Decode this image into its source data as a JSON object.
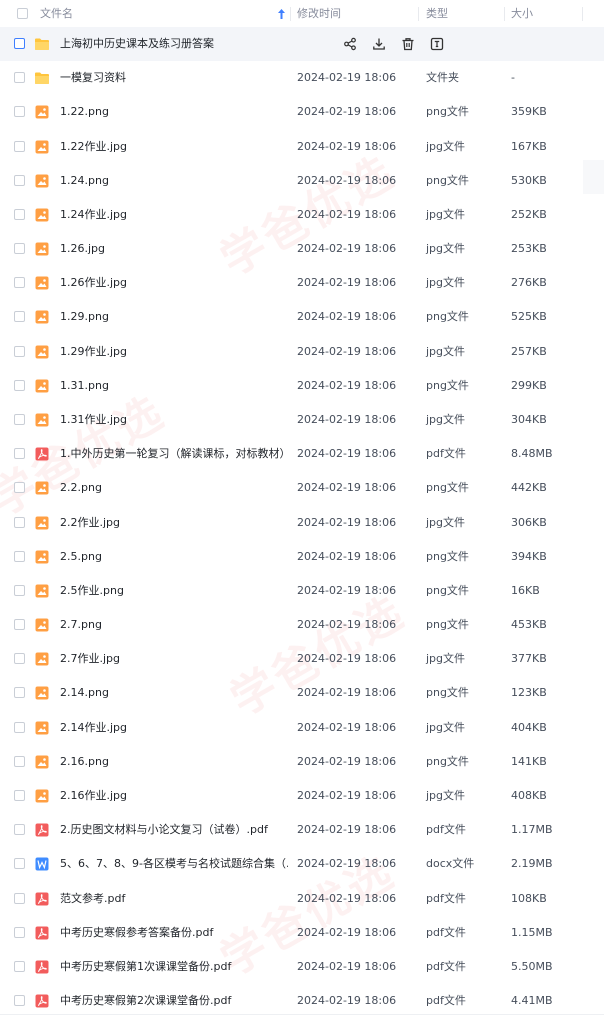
{
  "header": {
    "col_name": "文件名",
    "col_date": "修改时间",
    "col_type": "类型",
    "col_size": "大小"
  },
  "colors": {
    "accent": "#3f7fff",
    "folder": "#ffc53d",
    "image": "#ff9f43",
    "pdf": "#f25c5c",
    "word": "#3f8cff"
  },
  "selected_row_actions": [
    "share-icon",
    "download-icon",
    "delete-icon",
    "rename-icon"
  ],
  "rows": [
    {
      "name": "上海初中历史课本及练习册答案",
      "date": "",
      "type": "",
      "size": "",
      "icon": "folder"
    },
    {
      "name": "一模复习资料",
      "date": "2024-02-19 18:06",
      "type": "文件夹",
      "size": "-",
      "icon": "folder"
    },
    {
      "name": "1.22.png",
      "date": "2024-02-19 18:06",
      "type": "png文件",
      "size": "359KB",
      "icon": "image"
    },
    {
      "name": "1.22作业.jpg",
      "date": "2024-02-19 18:06",
      "type": "jpg文件",
      "size": "167KB",
      "icon": "image"
    },
    {
      "name": "1.24.png",
      "date": "2024-02-19 18:06",
      "type": "png文件",
      "size": "530KB",
      "icon": "image"
    },
    {
      "name": "1.24作业.jpg",
      "date": "2024-02-19 18:06",
      "type": "jpg文件",
      "size": "252KB",
      "icon": "image"
    },
    {
      "name": "1.26.jpg",
      "date": "2024-02-19 18:06",
      "type": "jpg文件",
      "size": "253KB",
      "icon": "image"
    },
    {
      "name": "1.26作业.jpg",
      "date": "2024-02-19 18:06",
      "type": "jpg文件",
      "size": "276KB",
      "icon": "image"
    },
    {
      "name": "1.29.png",
      "date": "2024-02-19 18:06",
      "type": "png文件",
      "size": "525KB",
      "icon": "image"
    },
    {
      "name": "1.29作业.jpg",
      "date": "2024-02-19 18:06",
      "type": "jpg文件",
      "size": "257KB",
      "icon": "image"
    },
    {
      "name": "1.31.png",
      "date": "2024-02-19 18:06",
      "type": "png文件",
      "size": "299KB",
      "icon": "image"
    },
    {
      "name": "1.31作业.jpg",
      "date": "2024-02-19 18:06",
      "type": "jpg文件",
      "size": "304KB",
      "icon": "image"
    },
    {
      "name": "1.中外历史第一轮复习（解读课标，对标教材）....",
      "date": "2024-02-19 18:06",
      "type": "pdf文件",
      "size": "8.48MB",
      "icon": "pdf"
    },
    {
      "name": "2.2.png",
      "date": "2024-02-19 18:06",
      "type": "png文件",
      "size": "442KB",
      "icon": "image"
    },
    {
      "name": "2.2作业.jpg",
      "date": "2024-02-19 18:06",
      "type": "jpg文件",
      "size": "306KB",
      "icon": "image"
    },
    {
      "name": "2.5.png",
      "date": "2024-02-19 18:06",
      "type": "png文件",
      "size": "394KB",
      "icon": "image"
    },
    {
      "name": "2.5作业.png",
      "date": "2024-02-19 18:06",
      "type": "png文件",
      "size": "16KB",
      "icon": "image"
    },
    {
      "name": "2.7.png",
      "date": "2024-02-19 18:06",
      "type": "png文件",
      "size": "453KB",
      "icon": "image"
    },
    {
      "name": "2.7作业.jpg",
      "date": "2024-02-19 18:06",
      "type": "jpg文件",
      "size": "377KB",
      "icon": "image"
    },
    {
      "name": "2.14.png",
      "date": "2024-02-19 18:06",
      "type": "png文件",
      "size": "123KB",
      "icon": "image"
    },
    {
      "name": "2.14作业.jpg",
      "date": "2024-02-19 18:06",
      "type": "jpg文件",
      "size": "404KB",
      "icon": "image"
    },
    {
      "name": "2.16.png",
      "date": "2024-02-19 18:06",
      "type": "png文件",
      "size": "141KB",
      "icon": "image"
    },
    {
      "name": "2.16作业.jpg",
      "date": "2024-02-19 18:06",
      "type": "jpg文件",
      "size": "408KB",
      "icon": "image"
    },
    {
      "name": "2.历史图文材料与小论文复习（试卷）.pdf",
      "date": "2024-02-19 18:06",
      "type": "pdf文件",
      "size": "1.17MB",
      "icon": "pdf"
    },
    {
      "name": "5、6、7、8、9-各区模考与名校试题综合集（...",
      "date": "2024-02-19 18:06",
      "type": "docx文件",
      "size": "2.19MB",
      "icon": "word"
    },
    {
      "name": "范文参考.pdf",
      "date": "2024-02-19 18:06",
      "type": "pdf文件",
      "size": "108KB",
      "icon": "pdf"
    },
    {
      "name": "中考历史寒假参考答案备份.pdf",
      "date": "2024-02-19 18:06",
      "type": "pdf文件",
      "size": "1.15MB",
      "icon": "pdf"
    },
    {
      "name": "中考历史寒假第1次课课堂备份.pdf",
      "date": "2024-02-19 18:06",
      "type": "pdf文件",
      "size": "5.50MB",
      "icon": "pdf"
    },
    {
      "name": "中考历史寒假第2次课课堂备份.pdf",
      "date": "2024-02-19 18:06",
      "type": "pdf文件",
      "size": "4.41MB",
      "icon": "pdf"
    }
  ]
}
